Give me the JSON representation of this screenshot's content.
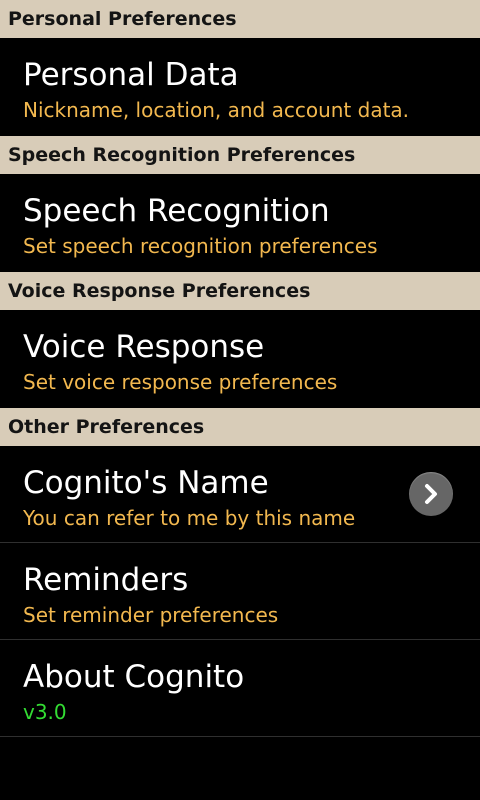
{
  "sections": [
    {
      "header": "Personal Preferences",
      "items": [
        {
          "title": "Personal Data",
          "summary": "Nickname, location, and account data."
        }
      ]
    },
    {
      "header": "Speech Recognition Preferences",
      "items": [
        {
          "title": "Speech Recognition",
          "summary": "Set speech recognition preferences"
        }
      ]
    },
    {
      "header": "Voice Response Preferences",
      "items": [
        {
          "title": "Voice Response",
          "summary": "Set voice response preferences"
        }
      ]
    },
    {
      "header": "Other Preferences",
      "items": [
        {
          "title": "Cognito's Name",
          "summary": "You can refer to me by this name",
          "icon": "chevron-right-icon"
        },
        {
          "title": "Reminders",
          "summary": "Set reminder preferences"
        },
        {
          "title": "About Cognito",
          "summary": "v3.0"
        }
      ]
    }
  ],
  "colors": {
    "background": "#000000",
    "section_header_bg": "#d8ccb8",
    "section_header_text": "#141414",
    "title_text": "#ffffff",
    "summary_text": "#f2b84f",
    "version_text": "#33dd33"
  }
}
